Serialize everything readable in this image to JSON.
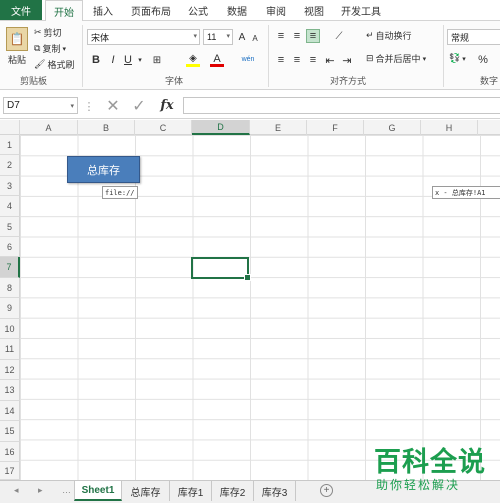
{
  "tabs": {
    "file": "文件",
    "home": "开始",
    "insert": "插入",
    "layout": "页面布局",
    "formula": "公式",
    "data": "数据",
    "review": "审阅",
    "view": "视图",
    "dev": "开发工具"
  },
  "clipboard": {
    "paste": "粘贴",
    "cut": "剪切",
    "copy": "复制",
    "painter": "格式刷",
    "label": "剪贴板"
  },
  "font": {
    "name": "宋体",
    "size": "11",
    "label": "字体",
    "bold": "B",
    "italic": "I",
    "underline": "U",
    "grow": "A",
    "shrink": "A",
    "color_a": "A",
    "wen": "wén"
  },
  "align": {
    "wrap": "自动换行",
    "merge": "合并后居中",
    "label": "对齐方式"
  },
  "number": {
    "format": "常规",
    "percent": "%",
    "label": "数字"
  },
  "formula_bar": {
    "cell_ref": "D7",
    "fx": "fx"
  },
  "columns": [
    "A",
    "B",
    "C",
    "D",
    "E",
    "F",
    "G",
    "H"
  ],
  "rows": [
    "1",
    "2",
    "3",
    "4",
    "5",
    "6",
    "7",
    "8",
    "9",
    "10",
    "11",
    "12",
    "13",
    "14",
    "15",
    "16",
    "17"
  ],
  "shape": {
    "text": "总库存"
  },
  "tooltip": {
    "left": "file://",
    "right": "x - 总库存!A1"
  },
  "sheets": [
    "Sheet1",
    "总库存",
    "库存1",
    "库存2",
    "库存3"
  ],
  "add_sheet": "+",
  "watermark": {
    "title": "百科全说",
    "subtitle": "助你轻松解决"
  },
  "colors": {
    "excel_green": "#217346",
    "shape_fill": "#4a7ebb",
    "watermark": "#1c9e4f"
  }
}
